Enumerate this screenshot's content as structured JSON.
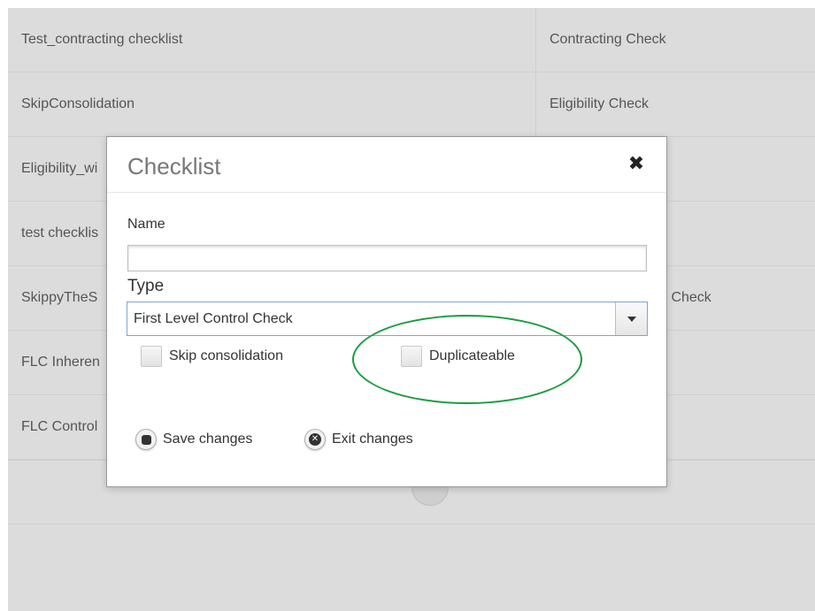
{
  "table": {
    "rows": [
      {
        "name": "Test_contracting checklist",
        "type": "Contracting Check"
      },
      {
        "name": "SkipConsolidation",
        "type": "Eligibility Check"
      },
      {
        "name": "Eligibility_wi",
        "type": ""
      },
      {
        "name": "test checklis",
        "type": ""
      },
      {
        "name": "SkippyTheS",
        "type": "y Check"
      },
      {
        "name": "FLC Inheren",
        "type": ""
      },
      {
        "name": "FLC Control",
        "type": ""
      },
      {
        "name": "",
        "type": ""
      }
    ]
  },
  "modal": {
    "title": "Checklist",
    "close_glyph": "✖",
    "name_label": "Name",
    "name_value": "",
    "type_label": "Type",
    "type_value": "First Level Control Check",
    "skip_consolidation_label": "Skip consolidation",
    "duplicateable_label": "Duplicateable",
    "save_label": "Save changes",
    "exit_label": "Exit changes"
  },
  "colors": {
    "annotation": "#1a9c3e",
    "select_focus_border": "#7ea2e0",
    "background_table": "#dcdcdc"
  },
  "icons": {
    "close": "close-icon",
    "select_caret": "chevron-down-icon",
    "save": "save-icon",
    "exit": "close-circle-icon"
  }
}
